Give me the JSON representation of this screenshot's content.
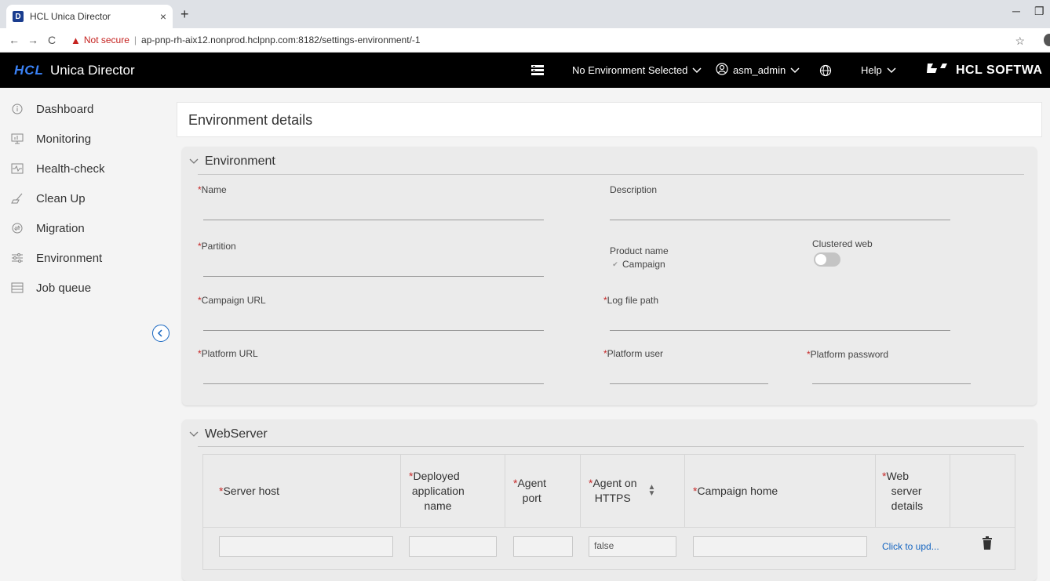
{
  "browser": {
    "tab_title": "HCL Unica Director",
    "favicon_letter": "D",
    "tab_close": "×",
    "new_tab": "+",
    "security_label": "Not secure",
    "url": "ap-pnp-rh-aix12.nonprod.hclpnp.com:8182/settings-environment/-1"
  },
  "header": {
    "logo": "HCL",
    "app_name": "Unica Director",
    "environment_selector": "No Environment Selected",
    "user": "asm_admin",
    "help": "Help",
    "brand": "HCL SOFTWA"
  },
  "sidebar": {
    "items": [
      {
        "label": "Dashboard",
        "icon": "info-circle-icon"
      },
      {
        "label": "Monitoring",
        "icon": "monitor-icon"
      },
      {
        "label": "Health-check",
        "icon": "heartbeat-icon"
      },
      {
        "label": "Clean Up",
        "icon": "broom-icon"
      },
      {
        "label": "Migration",
        "icon": "migration-icon"
      },
      {
        "label": "Environment",
        "icon": "sliders-icon"
      },
      {
        "label": "Job queue",
        "icon": "queue-icon"
      }
    ]
  },
  "page": {
    "title": "Environment details"
  },
  "environment": {
    "section_title": "Environment",
    "name_label": "Name",
    "description_label": "Description",
    "partition_label": "Partition",
    "product_name_label": "Product name",
    "product_campaign": "Campaign",
    "clustered_web_label": "Clustered web",
    "campaign_url_label": "Campaign URL",
    "log_file_path_label": "Log file path",
    "platform_url_label": "Platform URL",
    "platform_user_label": "Platform user",
    "platform_password_label": "Platform password",
    "required_mark": "*"
  },
  "webserver": {
    "section_title": "WebServer",
    "columns": {
      "server_host": "Server host",
      "deployed_app_line1": "Deployed",
      "deployed_app_line2": "application",
      "deployed_app_line3": "name",
      "agent_port_line1": "Agent",
      "agent_port_line2": "port",
      "agent_https_line1": "Agent on",
      "agent_https_line2": "HTTPS",
      "campaign_home": "Campaign home",
      "web_server_line1": "Web",
      "web_server_line2": "server",
      "web_server_line3": "details"
    },
    "row": {
      "agent_https_value": "false",
      "details_link": "Click to upd..."
    }
  },
  "colors": {
    "header_bg": "#000000",
    "accent": "#1565c0",
    "required": "#c62828"
  }
}
